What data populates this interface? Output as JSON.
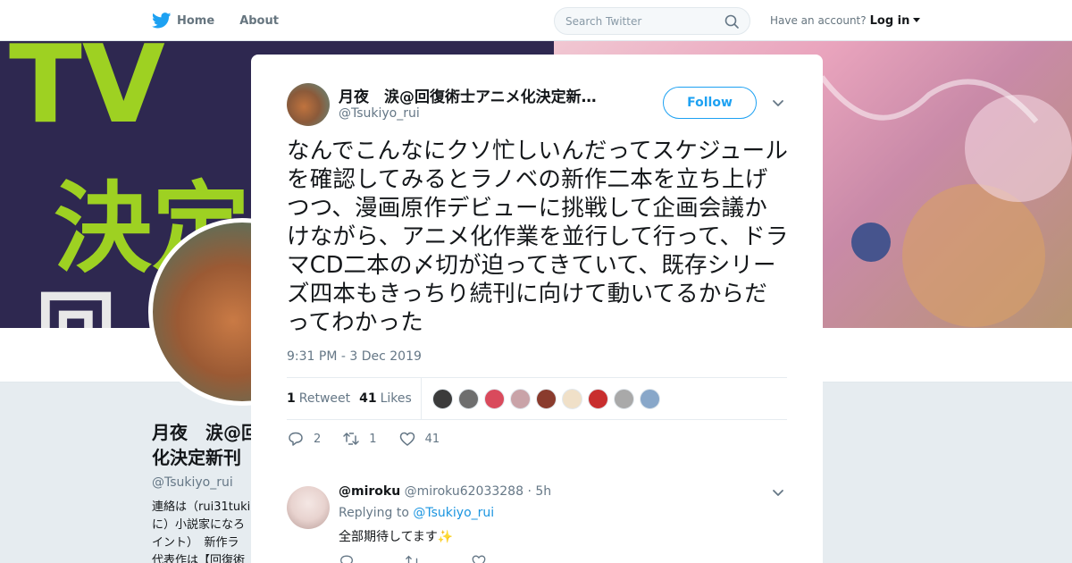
{
  "nav": {
    "home_label": "Home",
    "about_label": "About",
    "search_placeholder": "Search Twitter",
    "account_prompt": "Have an account?",
    "login_label": "Log in"
  },
  "profile": {
    "name": "月夜　涙@回\n化決定新刊",
    "handle": "@Tsukiyo_rui",
    "bio": "連絡は（rui31tuki\nに）小説家になろ\nイント）　新作ラ\n代表作は【回復術"
  },
  "banner": {
    "text_top": "TV",
    "text_middle": "決定",
    "text_bottom": "回"
  },
  "tweet": {
    "author_name": "月夜　涙@回復術士アニメ化決定新…",
    "author_handle": "@Tsukiyo_rui",
    "follow_label": "Follow",
    "text": "なんでこんなにクソ忙しいんだってスケジュールを確認してみるとラノベの新作二本を立ち上げつつ、漫画原作デビューに挑戦して企画会議かけながら、アニメ化作業を並行して行って、ドラマCD二本の〆切が迫ってきていて、既存シリーズ四本もきっちり続刊に向けて動いてるからだってわかった",
    "timestamp": "9:31 PM - 3 Dec 2019",
    "retweet_count": "1",
    "retweet_label": "Retweet",
    "like_count": "41",
    "like_label": "Likes",
    "reply_action_count": "2",
    "retweet_action_count": "1",
    "like_action_count": "41"
  },
  "likers": [
    {
      "color": "#3b3b3b"
    },
    {
      "color": "#6e6e6e"
    },
    {
      "color": "#d94a5c"
    },
    {
      "color": "#c9a3a8"
    },
    {
      "color": "#8a3b2d"
    },
    {
      "color": "#f0e0c8"
    },
    {
      "color": "#c82e2e"
    },
    {
      "color": "#a9a9a9"
    },
    {
      "color": "#88a7c9"
    }
  ],
  "reply": {
    "name": "@miroku",
    "handle": "@miroku62033288",
    "time": "5h",
    "replying_label": "Replying to",
    "replying_to": "@Tsukiyo_rui",
    "text": "全部期待してます✨"
  },
  "colors": {
    "accent": "#1da1f2",
    "banner_green": "#9ed122"
  }
}
